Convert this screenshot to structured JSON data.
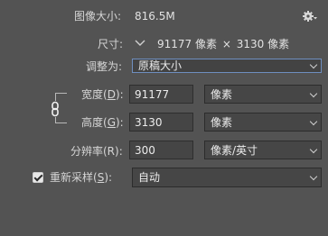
{
  "image_size": {
    "label": "图像大小:",
    "value": "816.5M"
  },
  "dimensions": {
    "label": "尺寸:",
    "width": "91177",
    "unit_w": "像素",
    "times": "×",
    "height": "3130",
    "unit_h": "像素"
  },
  "fit_to": {
    "label": "调整为:",
    "selected": "原稿大小"
  },
  "width": {
    "label_pre": "宽度(",
    "label_key": "D",
    "label_post": "):",
    "value": "91177",
    "unit": "像素"
  },
  "height": {
    "label_pre": "高度(",
    "label_key": "G",
    "label_post": "):",
    "value": "3130",
    "unit": "像素"
  },
  "resolution": {
    "label": "分辨率(R):",
    "value": "300",
    "unit": "像素/英寸"
  },
  "resample": {
    "label_pre": "重新采样(",
    "label_key": "S",
    "label_post": "):",
    "checked": true,
    "method": "自动"
  },
  "icons": {
    "settings": "gear-icon",
    "link": "link-chain-icon",
    "dims_toggle": "chevron-down-icon"
  },
  "colors": {
    "background": "#535353",
    "field": "#454545",
    "focus": "#6f8fbf"
  }
}
